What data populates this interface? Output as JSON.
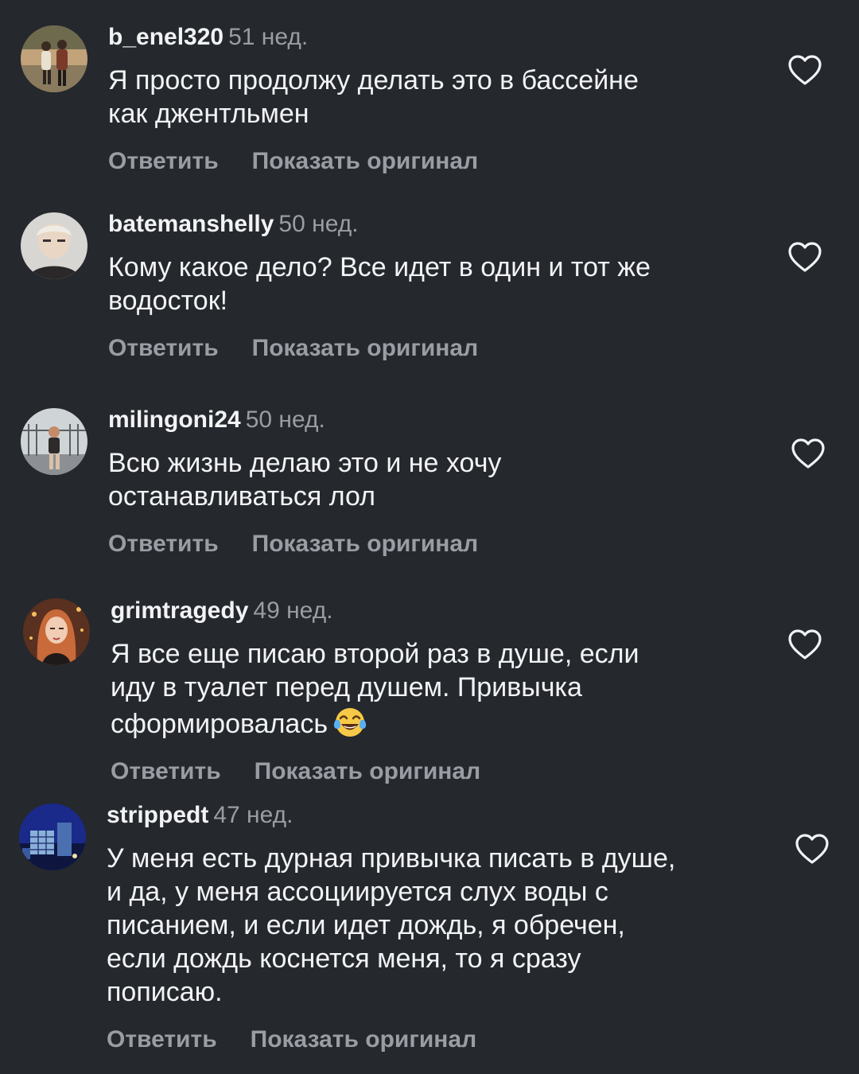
{
  "actions": {
    "reply": "Ответить",
    "show_original": "Показать оригинал"
  },
  "colors": {
    "background": "#25282d",
    "text": "#f2f3f5",
    "secondary": "#9a9da3"
  },
  "comments": [
    {
      "username": "b_enel320",
      "time": "51 нед.",
      "lines": [
        "Я просто продолжу делать это в бассейне",
        "как джентльмен"
      ],
      "avatar": "avatar-couple-walking"
    },
    {
      "username": "batemanshelly",
      "time": "50 нед.",
      "lines": [
        "Кому какое дело? Все идет в один и тот же",
        "водосток!"
      ],
      "avatar": "avatar-woman-selfie"
    },
    {
      "username": "milingoni24",
      "time": "50 нед.",
      "lines": [
        "Всю жизнь делаю это и не хочу",
        "останавливаться лол"
      ],
      "avatar": "avatar-person-fence"
    },
    {
      "username": "grimtragedy",
      "time": "49 нед.",
      "lines": [
        "Я все еще писаю второй раз в душе, если",
        "иду в туалет перед душем. Привычка",
        "сформировалась"
      ],
      "emoji": "tears-of-joy-emoji",
      "avatar": "avatar-woman-red-hair"
    },
    {
      "username": "strippedt",
      "time": "47 нед.",
      "lines": [
        "У меня есть дурная привычка писать в душе,",
        "и да, у меня ассоциируется слух воды с",
        "писанием, и если идет дождь, я обречен,",
        "если дождь коснется меня, то я сразу",
        "пописаю."
      ],
      "avatar": "avatar-city-night"
    }
  ]
}
